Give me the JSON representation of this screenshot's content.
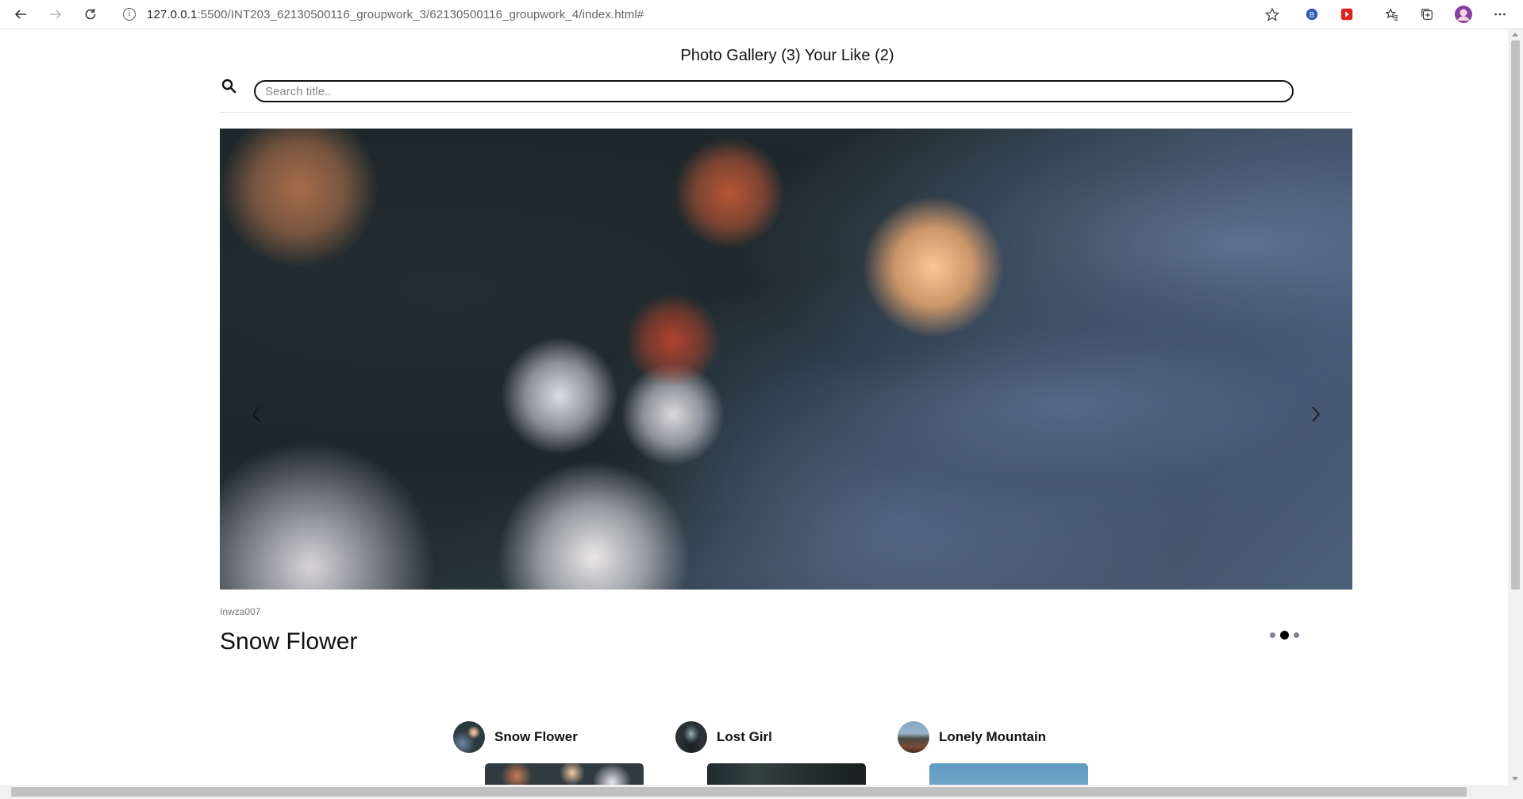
{
  "browser": {
    "url_host": "127.0.0.1",
    "url_rest": ":5500/INT203_62130500116_groupwork_3/62130500116_groupwork_4/index.html#"
  },
  "header": {
    "gallery_label": "Photo Gallery (3)",
    "like_label": "Your Like (2)"
  },
  "search": {
    "placeholder": "Search title..",
    "value": ""
  },
  "carousel": {
    "author": "Inwza007",
    "title": "Snow Flower",
    "active_index": 1,
    "count": 3
  },
  "cards": [
    {
      "name": "Snow Flower"
    },
    {
      "name": "Lost Girl"
    },
    {
      "name": "Lonely Mountain"
    }
  ],
  "colors": {
    "text": "#111111",
    "muted": "#777777",
    "border": "#111111"
  }
}
